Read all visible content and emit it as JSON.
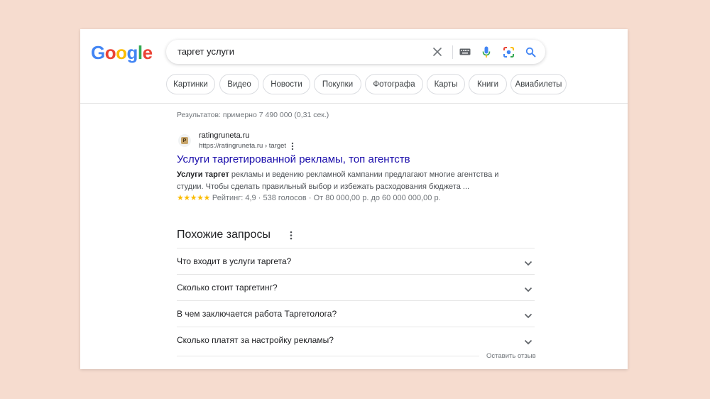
{
  "logo": {
    "letters": [
      "G",
      "o",
      "o",
      "g",
      "l",
      "e"
    ],
    "colors": [
      "#4285f4",
      "#ea4335",
      "#fbbc05",
      "#4285f4",
      "#34a853",
      "#ea4335"
    ]
  },
  "search": {
    "query": "таргет услуги",
    "icons": [
      "close-icon",
      "keyboard-icon",
      "microphone-icon",
      "lens-icon",
      "search-icon"
    ]
  },
  "chips": [
    "Картинки",
    "Видео",
    "Новости",
    "Покупки",
    "Фотографа",
    "Карты",
    "Книги",
    "Авиабилеты"
  ],
  "stats": "Результатов: примерно 7 490 000 (0,31 сек.)",
  "result": {
    "favicon_letter": "Р",
    "site_name": "ratingruneta.ru",
    "url": "https://ratingruneta.ru › target",
    "title": "Услуги таргетированной рекламы, топ агентств",
    "snippet_bold": "Услуги таргет",
    "snippet_rest": " рекламы и ведению рекламной кампании предлагают многие агентства и студии. Чтобы сделать правильный выбор и избежать расходования бюджета ...",
    "stars": "★★★★★",
    "rating": "Рейтинг: 4,9",
    "votes": "538 голосов",
    "price": "От 80 000,00 р. до 60 000 000,00 р.",
    "rating_value": 4.9
  },
  "related": {
    "title": "Похожие запросы",
    "questions": [
      "Что входит в услуги таргета?",
      "Сколько стоит таргетинг?",
      "В чем заключается работа Таргетолога?",
      "Сколько платят за настройку рекламы?"
    ],
    "feedback": "Оставить отзыв"
  },
  "colors": {
    "link": "#1a0dab",
    "accent_blue": "#4285f4",
    "star": "#fbbc04"
  }
}
